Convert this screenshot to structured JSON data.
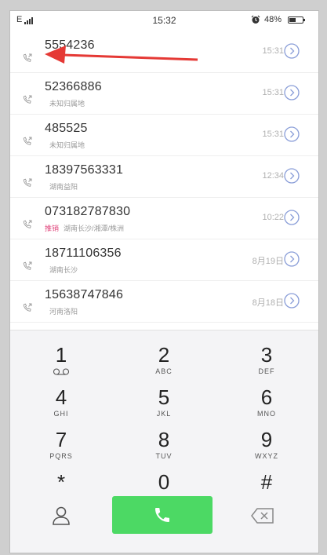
{
  "status_bar": {
    "carrier": "E",
    "time": "15:32",
    "battery": "48%",
    "battery_level": 0.48
  },
  "call_log": [
    {
      "number": "5554236",
      "location": "",
      "tag": "",
      "time": "15:31"
    },
    {
      "number": "52366886",
      "location": "未知归属地",
      "tag": "",
      "time": "15:31"
    },
    {
      "number": "485525",
      "location": "未知归属地",
      "tag": "",
      "time": "15:31"
    },
    {
      "number": "18397563331",
      "location": "湖南益阳",
      "tag": "",
      "time": "12:34"
    },
    {
      "number": "073182787830",
      "location": "湖南长沙/湘潭/株洲",
      "tag": "推销",
      "time": "10:22"
    },
    {
      "number": "18711106356",
      "location": "湖南长沙",
      "tag": "",
      "time": "8月19日"
    },
    {
      "number": "15638747846",
      "location": "河南洛阳",
      "tag": "",
      "time": "8月18日"
    }
  ],
  "keypad": [
    {
      "digit": "1",
      "letters": ""
    },
    {
      "digit": "2",
      "letters": "ABC"
    },
    {
      "digit": "3",
      "letters": "DEF"
    },
    {
      "digit": "4",
      "letters": "GHI"
    },
    {
      "digit": "5",
      "letters": "JKL"
    },
    {
      "digit": "6",
      "letters": "MNO"
    },
    {
      "digit": "7",
      "letters": "PQRS"
    },
    {
      "digit": "8",
      "letters": "TUV"
    },
    {
      "digit": "9",
      "letters": "WXYZ"
    },
    {
      "digit": "*",
      "letters": ""
    },
    {
      "digit": "0",
      "letters": "+"
    },
    {
      "digit": "#",
      "letters": ""
    }
  ],
  "icons": {
    "call_type": "outgoing-call-icon",
    "detail": "chevron-circle-icon",
    "contacts": "person-icon",
    "call": "phone-icon",
    "backspace": "backspace-icon",
    "voicemail": "voicemail-icon",
    "alarm": "alarm-clock-icon"
  },
  "colors": {
    "call_button": "#4cd964",
    "detail_icon": "#8a9ed8",
    "tag": "#e0457b",
    "annotation_arrow": "#e53935"
  }
}
